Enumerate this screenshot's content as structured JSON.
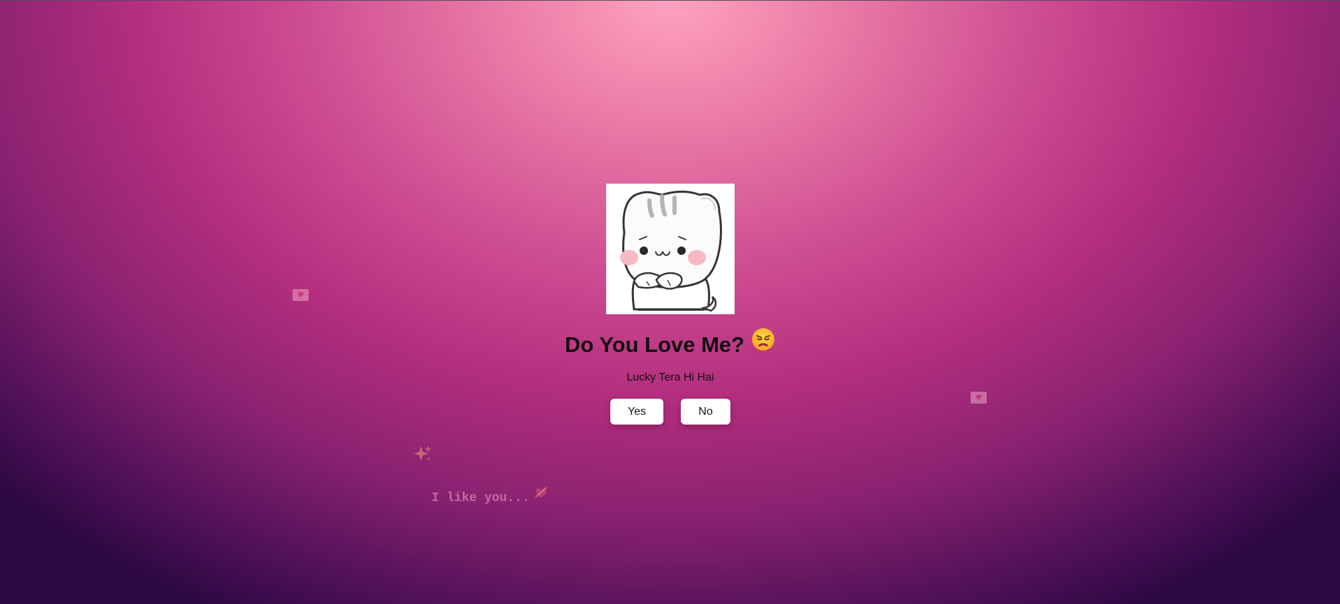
{
  "page": {
    "title": "Do You Love Me?",
    "title_emoji": "weary-face",
    "subtitle": "Lucky Tera Hi Hai"
  },
  "buttons": {
    "yes_label": "Yes",
    "no_label": "No"
  },
  "image": {
    "subject": "cute white kitten with blushing cheeks"
  },
  "floating": {
    "message": "I like you...",
    "message_icon": "heart-ribbon-icon",
    "hearts": [
      "love-letter-icon",
      "love-letter-icon"
    ],
    "sparkle_icon": "sparkles-icon"
  },
  "colors": {
    "background_center": "#ffa2be",
    "background_mid": "#b52f7f",
    "background_edge": "#2c0843",
    "button_bg": "#ffffff",
    "text": "#111111"
  }
}
